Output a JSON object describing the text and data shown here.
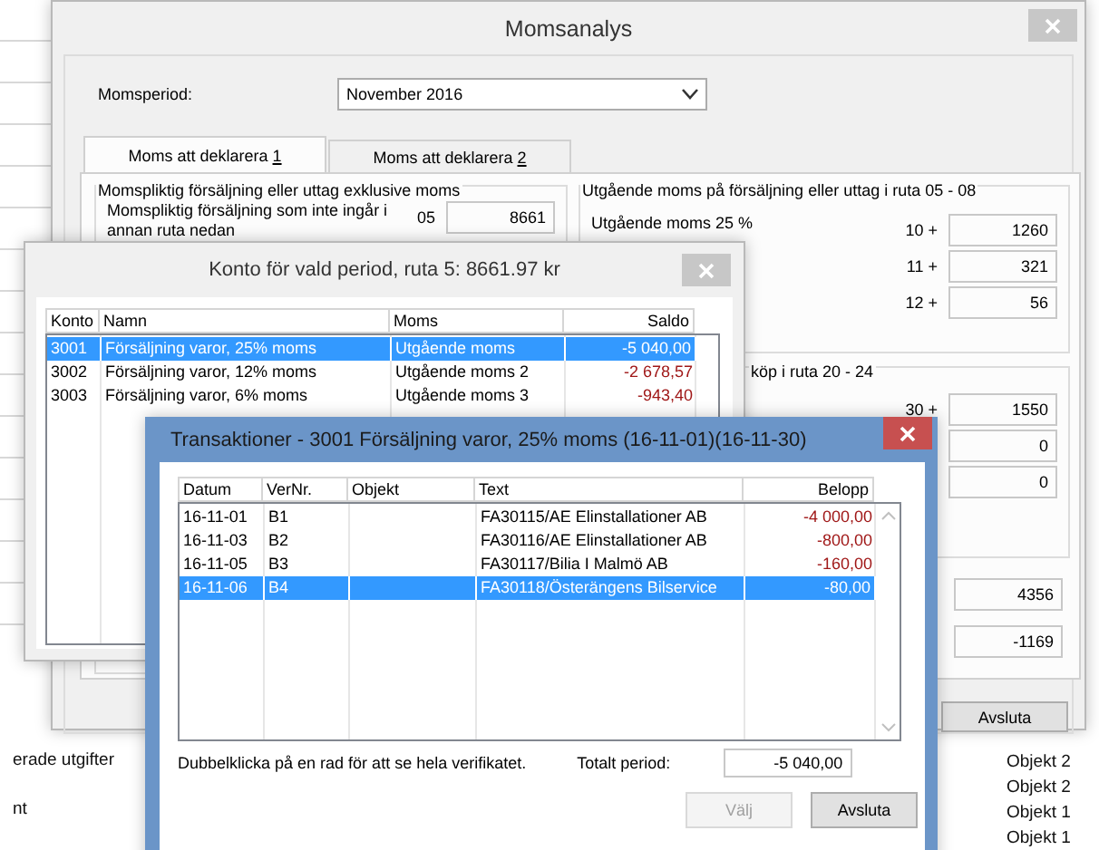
{
  "background": {
    "left_texts": [
      "erade utgifter",
      "nt"
    ],
    "right_texts": [
      "Objekt 2",
      "Objekt 2",
      "Objekt 1",
      "Objekt 1"
    ]
  },
  "moms_window": {
    "title": "Momsanalys",
    "period": {
      "label": "Momsperiod:",
      "value": "November 2016"
    },
    "tabs": [
      {
        "label": "Moms att deklarera",
        "key": "1",
        "selected": true
      },
      {
        "label": "Moms att deklarera",
        "key": "2",
        "selected": false
      }
    ],
    "sales_group": {
      "title": "Momspliktig försäljning eller uttag exklusive moms",
      "rows": [
        {
          "label": "Momspliktig försäljning som inte ingår i annan ruta nedan",
          "code": "05",
          "value": "8661"
        }
      ]
    },
    "output_vat_group": {
      "title": "Utgående moms på försäljning eller uttag i ruta 05 - 08",
      "rows": [
        {
          "label": "Utgående moms 25 %",
          "code": "10 +",
          "value": "1260"
        },
        {
          "code": "11 +",
          "value": "321"
        },
        {
          "code": "12 +",
          "value": "56"
        }
      ]
    },
    "purchase_group": {
      "title": "köp i ruta 20 - 24",
      "rows": [
        {
          "code": "30 +",
          "value": "1550"
        },
        {
          "value": "0"
        },
        {
          "value": "0"
        }
      ]
    },
    "totals": [
      {
        "value": "4356"
      },
      {
        "value": "-1169"
      }
    ],
    "button": "Avsluta"
  },
  "konto_window": {
    "title": "Konto för vald period, ruta 5: 8661.97 kr",
    "columns": [
      "Konto",
      "Namn",
      "Moms",
      "Saldo"
    ],
    "rows": [
      {
        "konto": "3001",
        "namn": "Försäljning varor, 25% moms",
        "moms": "Utgående moms",
        "saldo": "-5 040,00",
        "selected": true
      },
      {
        "konto": "3002",
        "namn": "Försäljning varor, 12% moms",
        "moms": "Utgående moms 2",
        "saldo": "-2 678,57",
        "selected": false
      },
      {
        "konto": "3003",
        "namn": "Försäljning varor, 6% moms",
        "moms": "Utgående moms 3",
        "saldo": "-943,40",
        "selected": false
      }
    ]
  },
  "transactions_window": {
    "title": "Transaktioner - 3001 Försäljning varor, 25% moms (16-11-01)(16-11-30)",
    "columns": [
      "Datum",
      "VerNr.",
      "Objekt",
      "Text",
      "Belopp"
    ],
    "rows": [
      {
        "datum": "16-11-01",
        "vernr": "B1",
        "text": "FA30115/AE Elinstallationer AB",
        "belopp": "-4 000,00",
        "selected": false
      },
      {
        "datum": "16-11-03",
        "vernr": "B2",
        "text": "FA30116/AE Elinstallationer AB",
        "belopp": "-800,00",
        "selected": false
      },
      {
        "datum": "16-11-05",
        "vernr": "B3",
        "text": "FA30117/Bilia I Malmö AB",
        "belopp": "-160,00",
        "selected": false
      },
      {
        "datum": "16-11-06",
        "vernr": "B4",
        "text": "FA30118/Österängens Bilservice",
        "belopp": "-80,00",
        "selected": true
      }
    ],
    "hint": "Dubbelklicka på en rad för att se hela verifikatet.",
    "total_label": "Totalt period:",
    "total_value": "-5 040,00",
    "buttons": [
      {
        "label": "Välj",
        "disabled": true
      },
      {
        "label": "Avsluta",
        "disabled": false
      }
    ]
  }
}
